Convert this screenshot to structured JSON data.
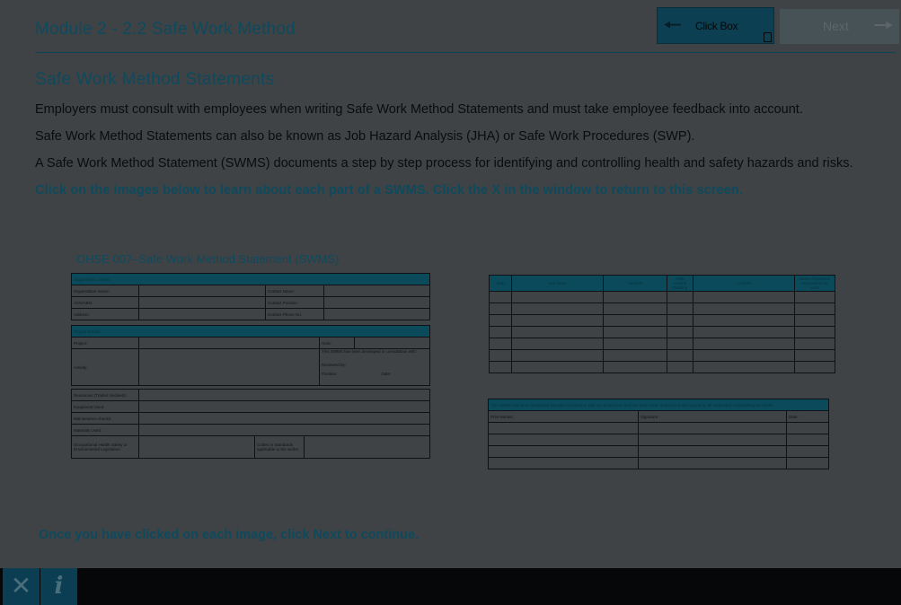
{
  "header": {
    "module_title": "Module 2 - 2.2 Safe Work Method",
    "back_label": "Click Box",
    "next_label": "Next",
    "back_icon": "arrow-left-icon",
    "next_icon": "arrow-right-icon"
  },
  "content": {
    "section_title": "Safe Work Method Statements",
    "paragraphs": [
      "Employers must consult with employees when writing Safe Work Method Statements and must take employee feedback into account.",
      "Safe Work Method Statements can also be known as Job Hazard Analysis (JHA) or Safe Work Procedures (SWP).",
      "A Safe Work Method Statement (SWMS) documents a step by step process for identifying and controlling health and safety hazards and risks."
    ],
    "instruction": "Click on the images below to learn about each part of a SWMS. Click the X in the window to return to this screen.",
    "footer_note": "Once you have clicked on each image, click Next to continue."
  },
  "form1": {
    "title": "OHSE 007–Safe Work Method Statement (SWMS)",
    "org_details": "Organisation Details",
    "org_name": "Organisation Name:",
    "contact_name": "Contact Name:",
    "acn": "ACN/ABN:",
    "contact_position": "Contact Position:",
    "address": "Address:",
    "contact_phone": "Contact Phone No:",
    "project_details": "Project Details",
    "project": "Project:",
    "area": "Area:",
    "activity": "Activity:",
    "developed": "This SWMS has been developed in consultation with:",
    "reviewed": "Reviewed by:",
    "position": "Position:",
    "date": "Date:",
    "resources": "Resources (Trades Involved):",
    "equipment": "Equipment Used:",
    "maintenance": "Maintenance checks:",
    "materials": "Materials Used:",
    "ohs_legislation": "Occupational Health Safety or Environmental Legislation:",
    "codes": "Codes or Standards applicable to the works:"
  },
  "form2": {
    "headers": [
      "Step",
      "Job steps",
      "Hazards",
      "Risk Control Ranking",
      "Controls",
      "Name of persons responsible for work"
    ]
  },
  "form3": {
    "banner": "This SWMS has been developed through consultation with our employees and has been read, understood and signed by all employees undertaking the works:",
    "headers": [
      "Print Names:",
      "Signature:",
      "Date:"
    ]
  },
  "bottombar": {
    "close_icon": "close-icon",
    "info_icon": "info-icon",
    "close_glyph": "✕",
    "info_glyph": "i"
  }
}
